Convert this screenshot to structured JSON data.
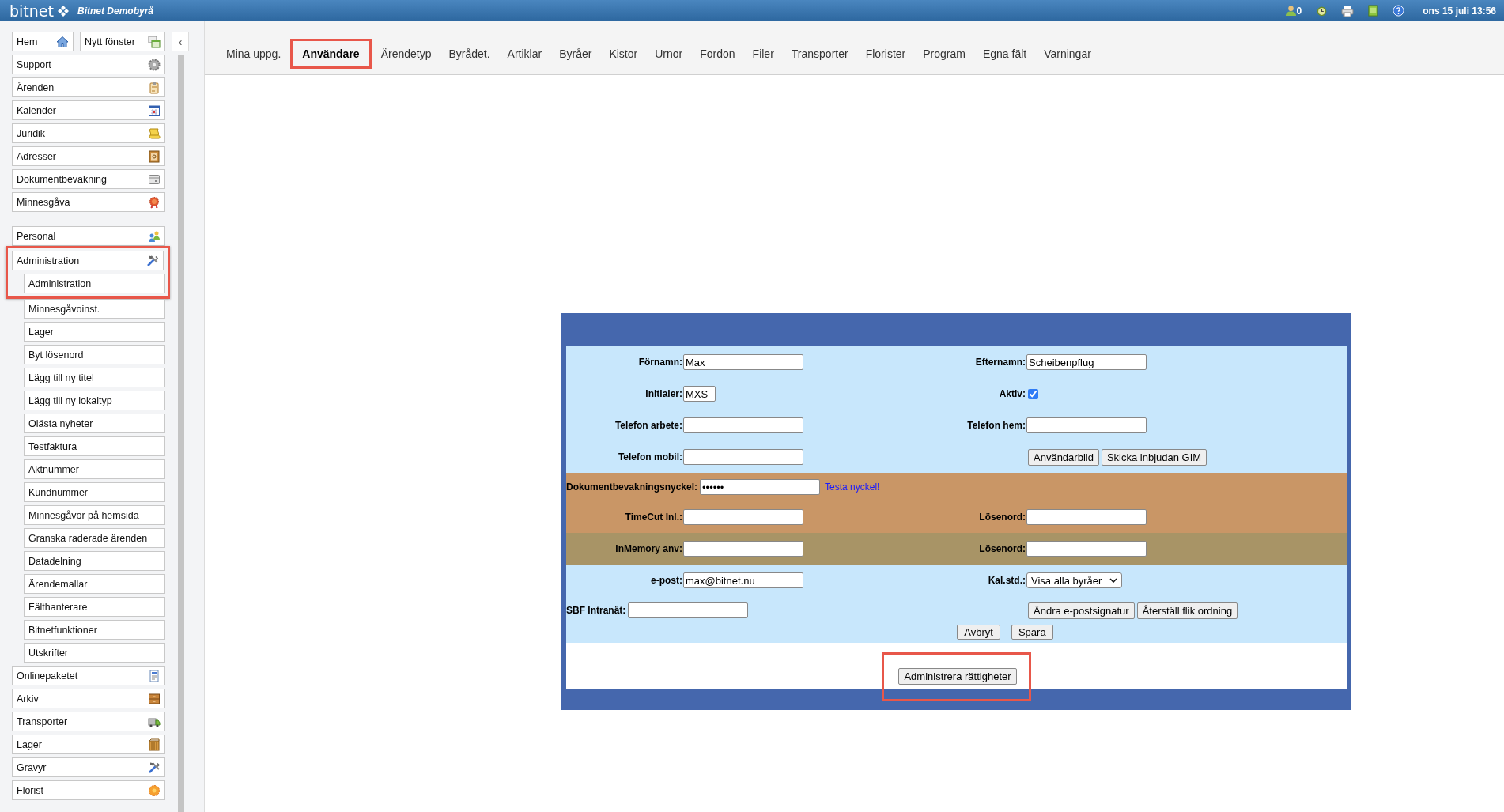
{
  "top_bar": {
    "logo": "bitnet",
    "organization": "Bitnet Demobyrå",
    "notification_count": "0",
    "datetime": "ons 15 juli 13:56"
  },
  "sidebar": {
    "top": [
      {
        "label": "Hem"
      },
      {
        "label": "Nytt fönster"
      }
    ],
    "collapse": "‹",
    "groups": [
      [
        {
          "label": "Support",
          "highlighted": false
        },
        {
          "label": "Ärenden",
          "highlighted": false
        },
        {
          "label": "Kalender",
          "highlighted": false
        },
        {
          "label": "Juridik",
          "highlighted": false
        },
        {
          "label": "Adresser",
          "highlighted": false
        },
        {
          "label": "Dokumentbevakning",
          "highlighted": false
        },
        {
          "label": "Minnesgåva",
          "highlighted": false
        }
      ],
      [
        {
          "label": "Personal",
          "highlighted": false
        },
        {
          "label": "Administration",
          "highlighted": true,
          "children": [
            {
              "label": "Administration",
              "highlighted": true
            },
            {
              "label": "Minnesgåvoinst.",
              "highlighted": false
            },
            {
              "label": "Lager",
              "highlighted": false
            },
            {
              "label": "Byt lösenord",
              "highlighted": false
            },
            {
              "label": "Lägg till ny titel",
              "highlighted": false
            },
            {
              "label": "Lägg till ny lokaltyp",
              "highlighted": false
            },
            {
              "label": "Olästa nyheter",
              "highlighted": false
            },
            {
              "label": "Testfaktura",
              "highlighted": false
            },
            {
              "label": "Aktnummer",
              "highlighted": false
            },
            {
              "label": "Kundnummer",
              "highlighted": false
            },
            {
              "label": "Minnesgåvor på hemsida",
              "highlighted": false
            },
            {
              "label": "Granska raderade ärenden",
              "highlighted": false
            },
            {
              "label": "Datadelning",
              "highlighted": false
            },
            {
              "label": "Ärendemallar",
              "highlighted": false
            },
            {
              "label": "Fälthanterare",
              "highlighted": false
            },
            {
              "label": "Bitnetfunktioner",
              "highlighted": false
            },
            {
              "label": "Utskrifter",
              "highlighted": false
            }
          ]
        },
        {
          "label": "Onlinepaketet",
          "highlighted": false
        },
        {
          "label": "Arkiv",
          "highlighted": false
        },
        {
          "label": "Transporter",
          "highlighted": false
        },
        {
          "label": "Lager",
          "highlighted": false
        },
        {
          "label": "Gravyr",
          "highlighted": false
        },
        {
          "label": "Florist",
          "highlighted": false
        }
      ]
    ]
  },
  "tabs": [
    {
      "label": "Mina uppg.",
      "selected": false,
      "highlighted": false
    },
    {
      "label": "Användare",
      "selected": true,
      "highlighted": true
    },
    {
      "label": "Ärendetyp",
      "selected": false,
      "highlighted": false
    },
    {
      "label": "Byrådet.",
      "selected": false,
      "highlighted": false
    },
    {
      "label": "Artiklar",
      "selected": false,
      "highlighted": false
    },
    {
      "label": "Byråer",
      "selected": false,
      "highlighted": false
    },
    {
      "label": "Kistor",
      "selected": false,
      "highlighted": false
    },
    {
      "label": "Urnor",
      "selected": false,
      "highlighted": false
    },
    {
      "label": "Fordon",
      "selected": false,
      "highlighted": false
    },
    {
      "label": "Filer",
      "selected": false,
      "highlighted": false
    },
    {
      "label": "Transporter",
      "selected": false,
      "highlighted": false
    },
    {
      "label": "Florister",
      "selected": false,
      "highlighted": false
    },
    {
      "label": "Program",
      "selected": false,
      "highlighted": false
    },
    {
      "label": "Egna fält",
      "selected": false,
      "highlighted": false
    },
    {
      "label": "Varningar",
      "selected": false,
      "highlighted": false
    }
  ],
  "form": {
    "sections": [
      {
        "color": "#c8e7fc",
        "rows": [
          {
            "kind": "grid",
            "left": {
              "kind": "text",
              "label": "Förnamn:",
              "value": "Max"
            },
            "right": {
              "kind": "text",
              "label": "Efternamn:",
              "value": "Scheibenpflug"
            }
          },
          {
            "kind": "grid",
            "left": {
              "kind": "short",
              "label": "Initialer:",
              "value": "MXS"
            },
            "right": {
              "kind": "checkbox",
              "label": "Aktiv:",
              "checked": true
            }
          },
          {
            "kind": "grid",
            "left": {
              "kind": "text",
              "label": "Telefon arbete:"
            },
            "right": {
              "kind": "text",
              "label": "Telefon hem:"
            }
          },
          {
            "kind": "grid",
            "left": {
              "kind": "text",
              "label": "Telefon mobil:"
            },
            "right": {
              "kind": "buttons",
              "buttons": [
                "Användarbild",
                "Skicka inbjudan GIM"
              ]
            }
          }
        ]
      },
      {
        "color": "#c99666",
        "rows": [
          {
            "kind": "inline",
            "left": {
              "kind": "text",
              "label": "Dokumentbevakningsnyckel:",
              "value": "••••••",
              "link": "Testa nyckel!"
            }
          },
          {
            "kind": "grid",
            "left": {
              "kind": "text",
              "label": "TimeCut Inl.:"
            },
            "right": {
              "kind": "text",
              "label": "Lösenord:"
            }
          }
        ]
      },
      {
        "color": "#a89466",
        "rows": [
          {
            "kind": "grid",
            "left": {
              "kind": "text",
              "label": "InMemory anv:"
            },
            "right": {
              "kind": "text",
              "label": "Lösenord:"
            }
          }
        ]
      },
      {
        "color": "#c8e7fc",
        "rows": [
          {
            "kind": "grid",
            "left": {
              "kind": "text",
              "label": "e-post:",
              "value": "max@bitnet.nu"
            },
            "right": {
              "kind": "select",
              "label": "Kal.std.:",
              "value": "Visa alla byråer"
            }
          },
          {
            "kind": "inline",
            "left": {
              "kind": "text",
              "label": "SBF Intranät:"
            },
            "right": {
              "kind": "buttons",
              "buttons": [
                "Ändra e-postsignatur",
                "Återställ flik ordning"
              ]
            }
          }
        ],
        "actions": [
          "Avbryt",
          "Spara"
        ]
      }
    ],
    "footer_button": {
      "label": "Administrera rättigheter",
      "highlighted": true
    }
  }
}
